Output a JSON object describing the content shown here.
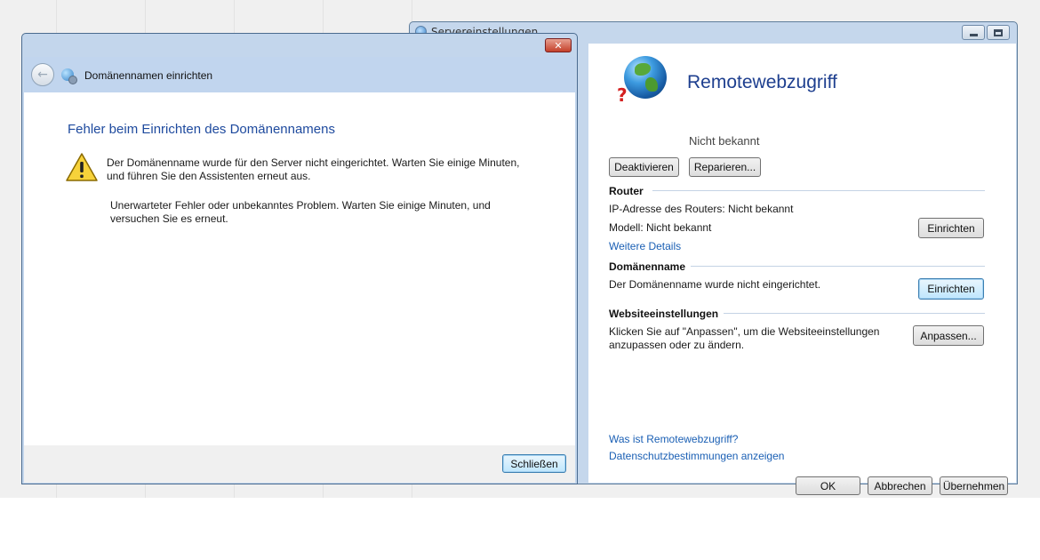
{
  "back_window": {
    "title": "Servereinstellungen",
    "heading": "Remotewebzugriff",
    "status": "Nicht bekannt",
    "buttons": {
      "deactivate": "Deaktivieren",
      "repair": "Reparieren..."
    },
    "router": {
      "header": "Router",
      "ip_line": "IP-Adresse des Routers: Nicht bekannt",
      "model_line": "Modell: Nicht bekannt",
      "setup_button": "Einrichten",
      "details_link": "Weitere Details"
    },
    "domain": {
      "header": "Domänenname",
      "text": "Der Domänenname wurde nicht eingerichtet.",
      "setup_button": "Einrichten"
    },
    "website": {
      "header": "Websiteeinstellungen",
      "text_line1": "Klicken Sie auf \"Anpassen\", um die Websiteeinstellungen",
      "text_line2": "anzupassen oder zu ändern.",
      "customize_button": "Anpassen..."
    },
    "links": {
      "what_is": "Was ist Remotewebzugriff?",
      "privacy": "Datenschutzbestimmungen anzeigen"
    },
    "footer": {
      "ok": "OK",
      "cancel": "Abbrechen",
      "apply": "Übernehmen"
    }
  },
  "front_dialog": {
    "header_title": "Domänennamen einrichten",
    "error_title": "Fehler beim Einrichten des Domänennamens",
    "message_line1": "Der Domänenname wurde für den Server nicht eingerichtet. Warten Sie einige Minuten,",
    "message_line2": "und führen Sie den Assistenten erneut aus.",
    "detail_line1": "Unerwarteter Fehler oder unbekanntes Problem. Warten Sie einige Minuten, und",
    "detail_line2": "versuchen Sie es erneut.",
    "close_button": "Schließen",
    "close_glyph": "✕"
  },
  "colors": {
    "title_blue": "#1e3f8f",
    "link_blue": "#1a5fb4",
    "frame_blue": "#c3d6ec",
    "warning_yellow": "#f7d23a"
  },
  "icons": {
    "globe": "globe-question-icon",
    "warning": "warning-icon",
    "back": "back-arrow-icon"
  }
}
